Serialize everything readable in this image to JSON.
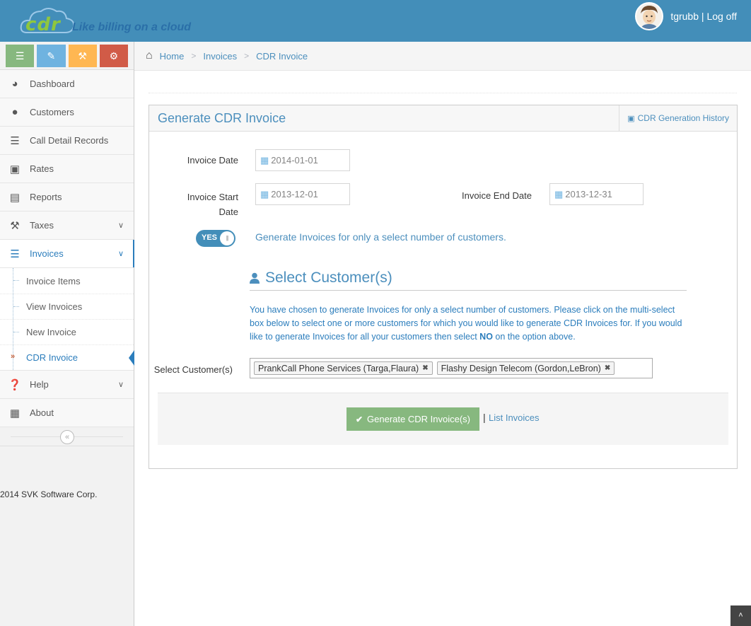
{
  "brand": {
    "logo_text": "cdr",
    "tagline": "Like billing on a cloud"
  },
  "user": {
    "name": "tgrubb",
    "separator": "|",
    "logoff": "Log off"
  },
  "shortcuts": [
    {
      "icon": "signal-icon",
      "color": "#87b87f"
    },
    {
      "icon": "pencil-icon",
      "color": "#6fb3e0"
    },
    {
      "icon": "gavel-icon",
      "color": "#ffb752"
    },
    {
      "icon": "cogs-icon",
      "color": "#d15b47"
    }
  ],
  "sidebar": {
    "items": [
      {
        "label": "Dashboard",
        "icon": "tachometer-icon"
      },
      {
        "label": "Customers",
        "icon": "users-icon"
      },
      {
        "label": "Call Detail Records",
        "icon": "list-icon"
      },
      {
        "label": "Rates",
        "icon": "money-icon"
      },
      {
        "label": "Reports",
        "icon": "file-icon"
      },
      {
        "label": "Taxes",
        "icon": "gavel-icon"
      },
      {
        "label": "Invoices",
        "icon": "list-ul-icon"
      },
      {
        "label": "Help",
        "icon": "question-circle-icon"
      },
      {
        "label": "About",
        "icon": "building-icon"
      }
    ],
    "invoice_sub": [
      {
        "label": "Invoice Items"
      },
      {
        "label": "View Invoices"
      },
      {
        "label": "New Invoice"
      },
      {
        "label": "CDR Invoice"
      }
    ],
    "footer": "2014 SVK Software Corp."
  },
  "breadcrumbs": {
    "home": "Home",
    "section": "Invoices",
    "current": "CDR Invoice",
    "sep": ">"
  },
  "widget": {
    "title": "Generate CDR Invoice",
    "tool_label": "CDR Generation History"
  },
  "form": {
    "invoice_date_label": "Invoice Date",
    "invoice_date": "2014-01-01",
    "start_label_1": "Invoice Start",
    "start_label_2": "Date",
    "start_date": "2013-12-01",
    "end_label": "Invoice End Date",
    "end_date": "2013-12-31",
    "toggle_label": "YES",
    "toggle_on": true,
    "toggle_text": "Generate Invoices for only a select number of customers.",
    "section_title": "Select Customer(s)",
    "info_1": "You have chosen to generate Invoices for only a select number of customers. Please click on the multi-select box below to select one or more customers for which you would like to generate CDR Invoices for. If you would like to generate Invoices for all your customers then select ",
    "info_bold": "NO",
    "info_2": " on the option above.",
    "customers_label": "Select Customer(s)",
    "selected_customers": [
      "PrankCall Phone Services (Targa,Flaura)",
      "Flashy Design Telecom (Gordon,LeBron)"
    ]
  },
  "actions": {
    "generate": "Generate CDR Invoice(s)",
    "separator": "|",
    "list": "List Invoices"
  },
  "colors": {
    "navbar": "#438eb9",
    "accent": "#4c8fbd",
    "success": "#87b87f"
  }
}
